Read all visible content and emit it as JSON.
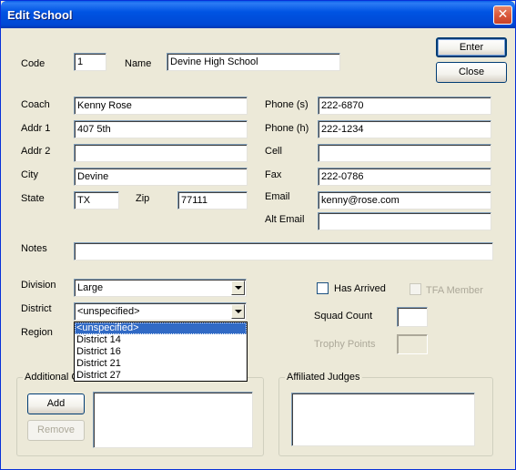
{
  "window": {
    "title": "Edit School",
    "close_glyph": "✕"
  },
  "buttons": {
    "enter": "Enter",
    "close": "Close",
    "add": "Add",
    "remove": "Remove"
  },
  "labels": {
    "code": "Code",
    "name": "Name",
    "coach": "Coach",
    "addr1": "Addr 1",
    "addr2": "Addr 2",
    "city": "City",
    "state": "State",
    "zip": "Zip",
    "phone_s": "Phone (s)",
    "phone_h": "Phone (h)",
    "cell": "Cell",
    "fax": "Fax",
    "email": "Email",
    "alt_email": "Alt Email",
    "notes": "Notes",
    "division": "Division",
    "district": "District",
    "region": "Region",
    "has_arrived": "Has Arrived",
    "tfa_member": "TFA Member",
    "squad_count": "Squad Count",
    "trophy_points": "Trophy Points"
  },
  "values": {
    "code": "1",
    "name": "Devine High School",
    "coach": "Kenny Rose",
    "addr1": "407 5th",
    "addr2": "",
    "city": "Devine",
    "state": "TX",
    "zip": "77111",
    "phone_s": "222-6870",
    "phone_h": "222-1234",
    "cell": "",
    "fax": "222-0786",
    "email": "kenny@rose.com",
    "alt_email": "",
    "notes": "",
    "division": "Large",
    "district": "<unspecified>",
    "squad_count": "",
    "trophy_points": "",
    "has_arrived": false,
    "tfa_member": false
  },
  "district_options": [
    "<unspecified>",
    "District 14",
    "District 16",
    "District 21",
    "District 27"
  ],
  "groups": {
    "additional": "Additional C",
    "affiliated_judges": "Affiliated Judges"
  },
  "icons": {
    "close": "close-icon",
    "dropdown": "chevron-down-icon"
  },
  "colors": {
    "titlebar": "#0054E3",
    "selection": "#316AC5",
    "dialog_bg": "#ECE9D8",
    "close_button": "#DA5A3C"
  }
}
